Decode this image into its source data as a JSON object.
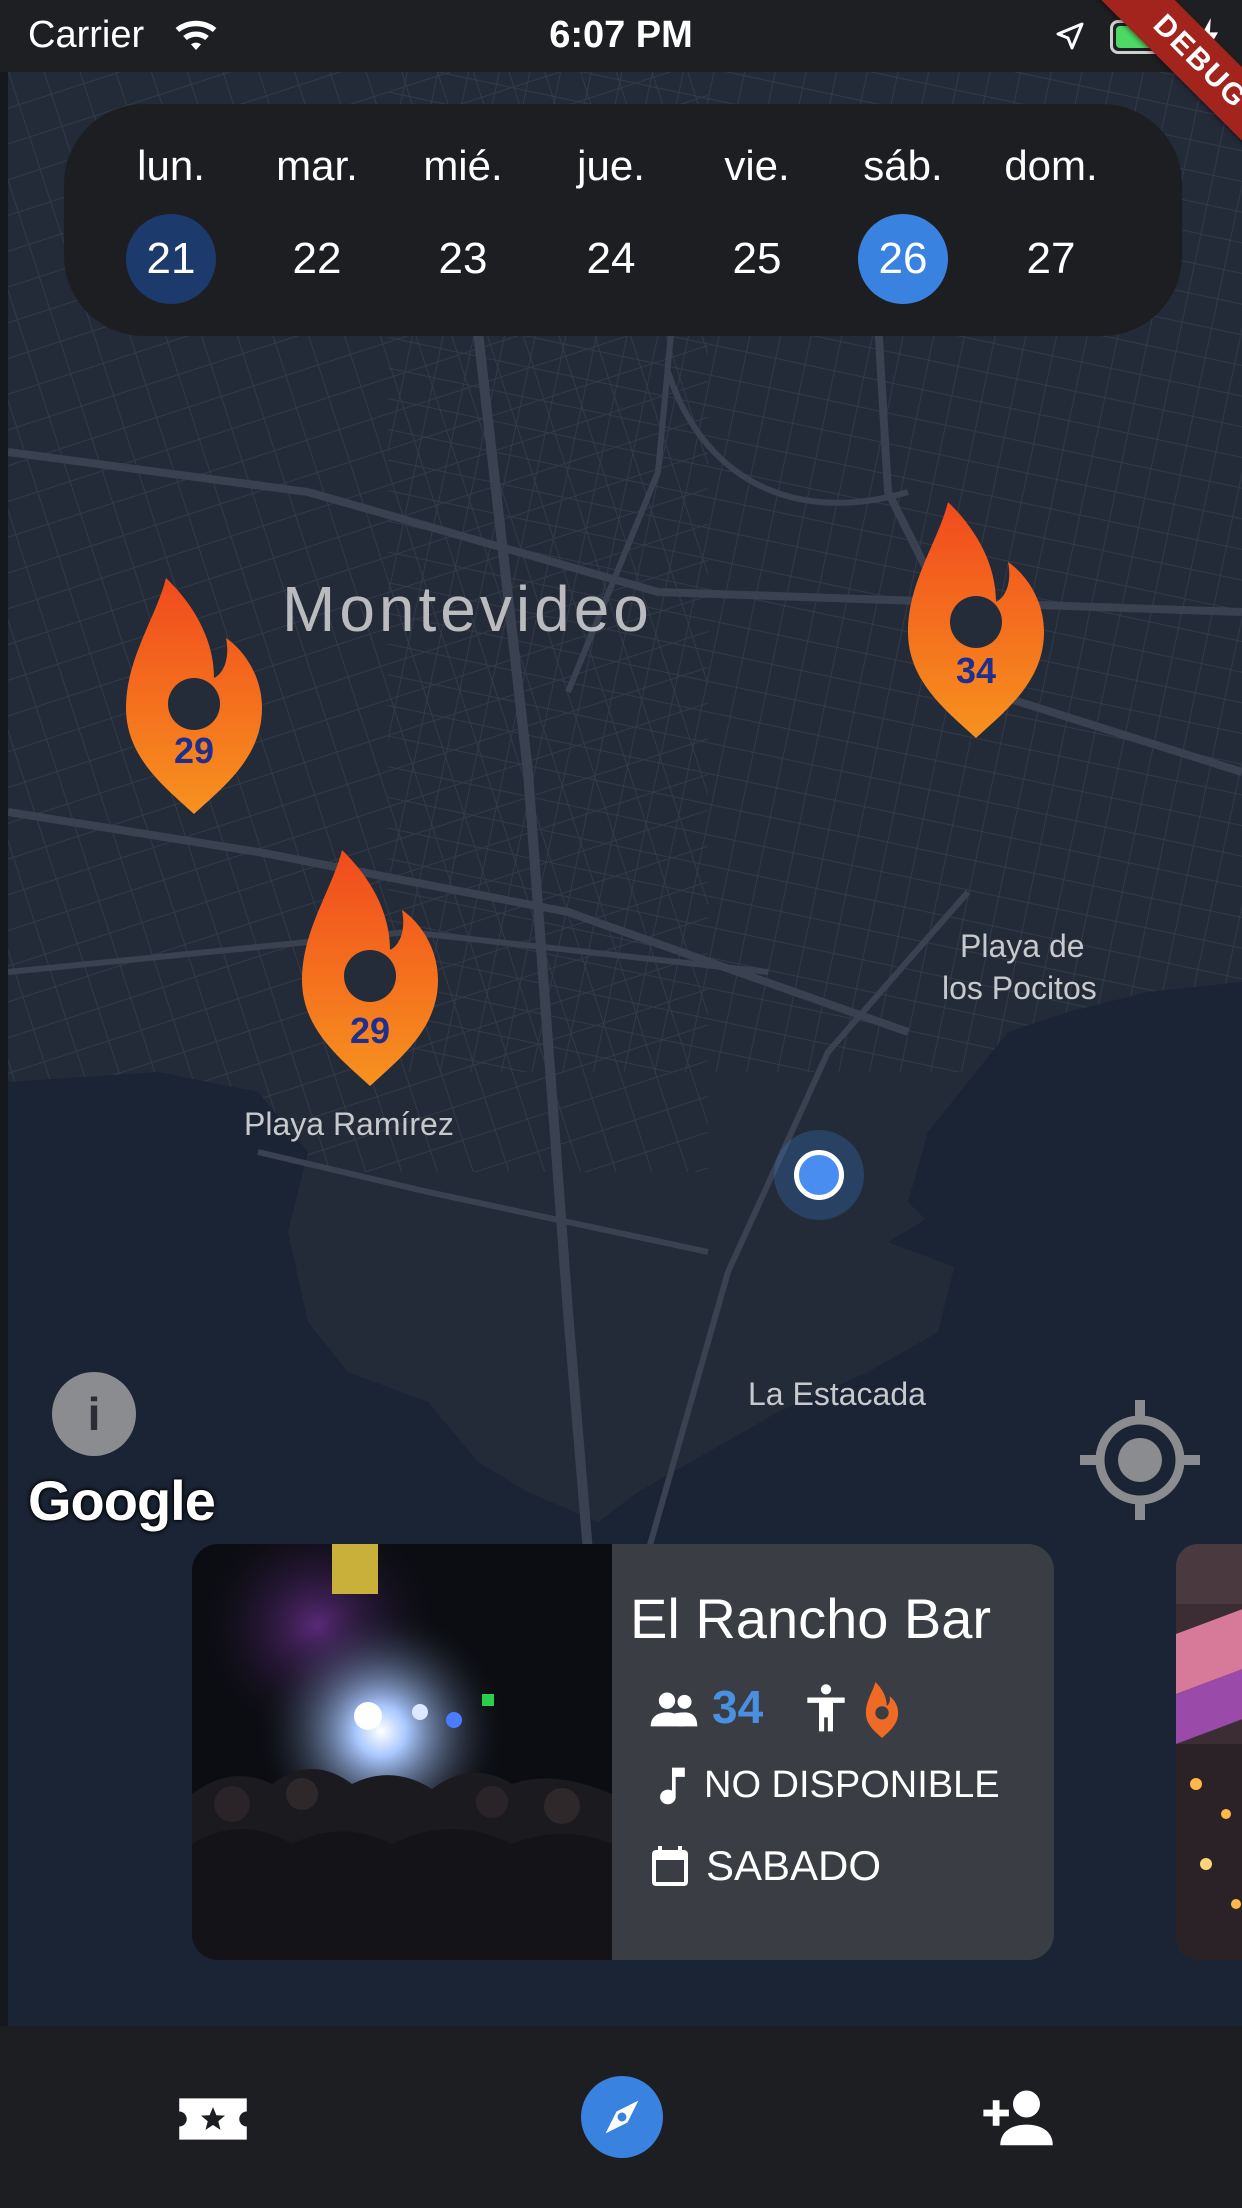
{
  "status_bar": {
    "carrier": "Carrier",
    "time": "6:07 PM",
    "debug_label": "DEBUG"
  },
  "week_selector": {
    "days": [
      {
        "name": "lun.",
        "number": "21",
        "state": "today"
      },
      {
        "name": "mar.",
        "number": "22",
        "state": "normal"
      },
      {
        "name": "mié.",
        "number": "23",
        "state": "normal"
      },
      {
        "name": "jue.",
        "number": "24",
        "state": "normal"
      },
      {
        "name": "vie.",
        "number": "25",
        "state": "normal"
      },
      {
        "name": "sáb.",
        "number": "26",
        "state": "selected"
      },
      {
        "name": "dom.",
        "number": "27",
        "state": "normal"
      }
    ]
  },
  "map": {
    "labels": {
      "city": "Montevideo",
      "beach_pocitos_line1": "Playa de",
      "beach_pocitos_line2": "los Pocitos",
      "beach_ramirez": "Playa Ramírez",
      "estacada": "La Estacada"
    },
    "pins": [
      {
        "count": "29"
      },
      {
        "count": "34"
      },
      {
        "count": "29"
      }
    ],
    "info_label": "i",
    "attribution": "Google"
  },
  "venue_card": {
    "title": "El Rancho Bar",
    "attendees": "34",
    "music": "NO DISPONIBLE",
    "day": "SABADO"
  },
  "colors": {
    "accent": "#3a82e0",
    "pin_gradient_top": "#f14a1e",
    "pin_gradient_bottom": "#f7921e",
    "today_circle": "#1c3a6b",
    "card_bg": "#3a3d44"
  },
  "icons": {
    "nav": [
      "ticket-star-icon",
      "compass-icon",
      "person-add-icon"
    ],
    "card": [
      "group-icon",
      "accessibility-icon",
      "fire-pin-icon",
      "music-note-icon",
      "calendar-icon"
    ]
  }
}
